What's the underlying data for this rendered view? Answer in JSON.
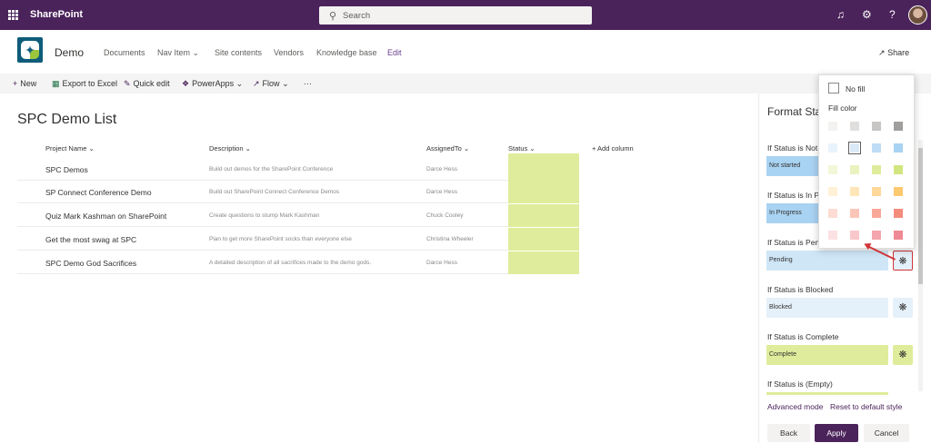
{
  "suitebar": {
    "brand": "SharePoint",
    "search_placeholder": "Search",
    "icons": [
      "waffle-icon",
      "bell-icon",
      "gear-icon",
      "help-icon",
      "avatar"
    ],
    "color": "#4b235b"
  },
  "site": {
    "title": "Demo",
    "nav": [
      "Documents",
      "Nav Item",
      "Site contents",
      "Vendors",
      "Knowledge base",
      "Edit"
    ],
    "share_label": "Share"
  },
  "commands": {
    "new": "New",
    "export": "Export to Excel",
    "quick_edit": "Quick edit",
    "powerapps": "PowerApps",
    "flow": "Flow",
    "more": "···"
  },
  "list": {
    "title": "SPC Demo List",
    "columns": [
      "Project Name",
      "Description",
      "AssignedTo",
      "Status",
      "+ Add column"
    ],
    "rows": [
      {
        "name": "SPC Demos",
        "desc": "Build out demos for the SharePoint Conference",
        "assigned": "Darce Hess"
      },
      {
        "name": "SP Connect Conference Demo",
        "desc": "Build out SharePoint Connect Conference Demos",
        "assigned": "Darce Hess"
      },
      {
        "name": "Quiz Mark Kashman on SharePoint",
        "desc": "Create questions to stump Mark Kashman",
        "assigned": "Chuck Cooley"
      },
      {
        "name": "Get the most swag at SPC",
        "desc": "Plan to get more SharePoint socks than everyone else",
        "assigned": "Christina Wheeler"
      },
      {
        "name": "SPC Demo God Sacrifices",
        "desc": "A detailed description of all sacrifices made to the demo gods.",
        "assigned": "Darce Hess"
      }
    ],
    "status_color": "#dfec9b"
  },
  "pane": {
    "title": "Format Sta",
    "rules": [
      {
        "label": "If Status is Not",
        "value": "Not started",
        "color": "#a9d3f2"
      },
      {
        "label": "If Status is In P",
        "value": "In Progress",
        "color": "#a9d3f2"
      },
      {
        "label": "If Status is Pen",
        "value": "Pending",
        "color": "#cfe6f7"
      },
      {
        "label": "If Status is Blocked",
        "value": "Blocked",
        "color": "#e5f1fa"
      },
      {
        "label": "If Status is Complete",
        "value": "Complete",
        "color": "#dfec9b"
      },
      {
        "label": "If Status is (Empty)",
        "value": "",
        "color": "#dfec9b"
      }
    ],
    "advanced_mode": "Advanced mode",
    "reset": "Reset to default style",
    "back": "Back",
    "apply": "Apply",
    "cancel": "Cancel"
  },
  "picker": {
    "no_fill": "No fill",
    "fill_color": "Fill color",
    "swatches": [
      [
        "#f3f2f1",
        "#e1dfdd",
        "#c8c6c4",
        "#a19f9d"
      ],
      [
        "#e8f3fc",
        "#dbe9f7",
        "#bfdcf5",
        "#a9d3f2"
      ],
      [
        "#f3f7d9",
        "#eaf3c0",
        "#dfec9b",
        "#d2e680"
      ],
      [
        "#fff1d6",
        "#ffe6b8",
        "#ffd89a",
        "#ffc970"
      ],
      [
        "#fddcd3",
        "#fbc6b8",
        "#f8a899",
        "#f48c7c"
      ],
      [
        "#fde0e2",
        "#fac7cb",
        "#f5a5ad",
        "#ef8a94"
      ]
    ],
    "selected": [
      1,
      1
    ]
  }
}
